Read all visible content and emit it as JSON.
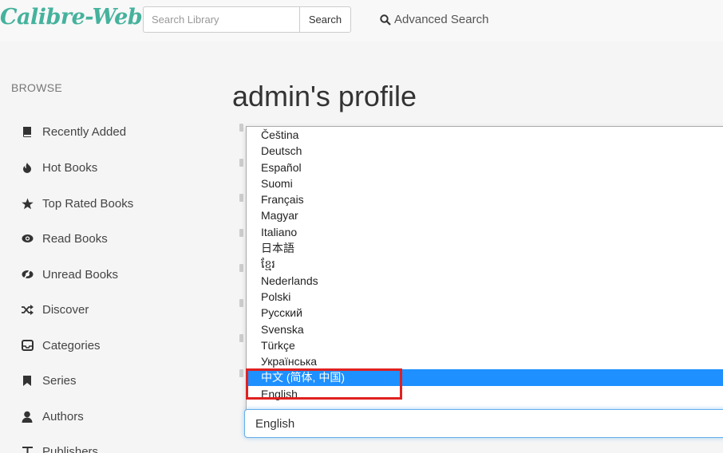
{
  "app": {
    "brand": "Calibre-Web"
  },
  "header": {
    "search_placeholder": "Search Library",
    "search_button": "Search",
    "advanced_search": "Advanced Search"
  },
  "sidebar": {
    "heading": "BROWSE",
    "items": [
      {
        "label": "Recently Added",
        "icon": "book-icon"
      },
      {
        "label": "Hot Books",
        "icon": "fire-icon"
      },
      {
        "label": "Top Rated Books",
        "icon": "star-icon"
      },
      {
        "label": "Read Books",
        "icon": "eye-icon"
      },
      {
        "label": "Unread Books",
        "icon": "eye-slash-icon"
      },
      {
        "label": "Discover",
        "icon": "shuffle-icon"
      },
      {
        "label": "Categories",
        "icon": "inbox-icon"
      },
      {
        "label": "Series",
        "icon": "bookmark-icon"
      },
      {
        "label": "Authors",
        "icon": "user-icon"
      },
      {
        "label": "Publishers",
        "icon": "text-size-icon"
      }
    ]
  },
  "main": {
    "title": "admin's profile",
    "language_options": [
      "Čeština",
      "Deutsch",
      "Español",
      "Suomi",
      "Français",
      "Magyar",
      "Italiano",
      "日本語",
      "ខ្មែរ",
      "Nederlands",
      "Polski",
      "Русский",
      "Svenska",
      "Türkçe",
      "Українська",
      "中文 (简体, 中国)",
      "English"
    ],
    "highlighted_option": "中文 (简体, 中国)",
    "selected_value": "English"
  },
  "colors": {
    "brand": "#45b29d",
    "option_highlight": "#1e90ff",
    "annotation": "#e02020"
  }
}
